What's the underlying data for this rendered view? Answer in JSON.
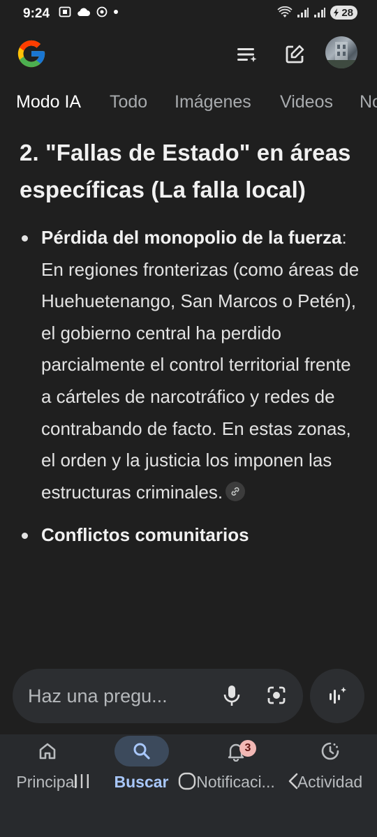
{
  "status_bar": {
    "time": "9:24",
    "battery": "28"
  },
  "header": {
    "logo_icon": "google-g-logo",
    "menu_icon": "history-sparkle-icon",
    "edit_icon": "new-edit-icon"
  },
  "tabs": [
    {
      "label": "Modo IA",
      "active": true
    },
    {
      "label": "Todo"
    },
    {
      "label": "Imágenes"
    },
    {
      "label": "Videos"
    },
    {
      "label": "No"
    }
  ],
  "content": {
    "heading": "2. \"Fallas de Estado\" en áreas específicas (La falla local)",
    "bullets": [
      {
        "bold": "Pérdida del monopolio de la fuerza",
        "text": ": En regiones fronterizas (como áreas de Huehuetenango, San Marcos o Petén), el gobierno central ha perdido parcialmente el control territorial frente a cárteles de narcotráfico y redes de contrabando de facto. En estas zonas, el orden y la justicia los imponen las estructuras criminales."
      },
      {
        "bold": "Conflictos comunitarios",
        "text": ""
      }
    ]
  },
  "ask_bar": {
    "placeholder": "Haz una pregu...",
    "mic_icon": "mic-icon",
    "lens_icon": "lens-icon",
    "ai_icon": "ai-voice-sparkle-icon"
  },
  "bottom_nav": [
    {
      "label": "Principal",
      "icon": "home-icon"
    },
    {
      "label": "Buscar",
      "icon": "search-icon",
      "active": true
    },
    {
      "label": "Notificaci...",
      "icon": "bell-icon",
      "badge": "3"
    },
    {
      "label": "Actividad",
      "icon": "activity-icon"
    }
  ],
  "colors": {
    "background": "#1f1f1f",
    "nav_background": "#282a2d",
    "accent": "#a8c7fa",
    "badge": "#f2b8b5"
  }
}
